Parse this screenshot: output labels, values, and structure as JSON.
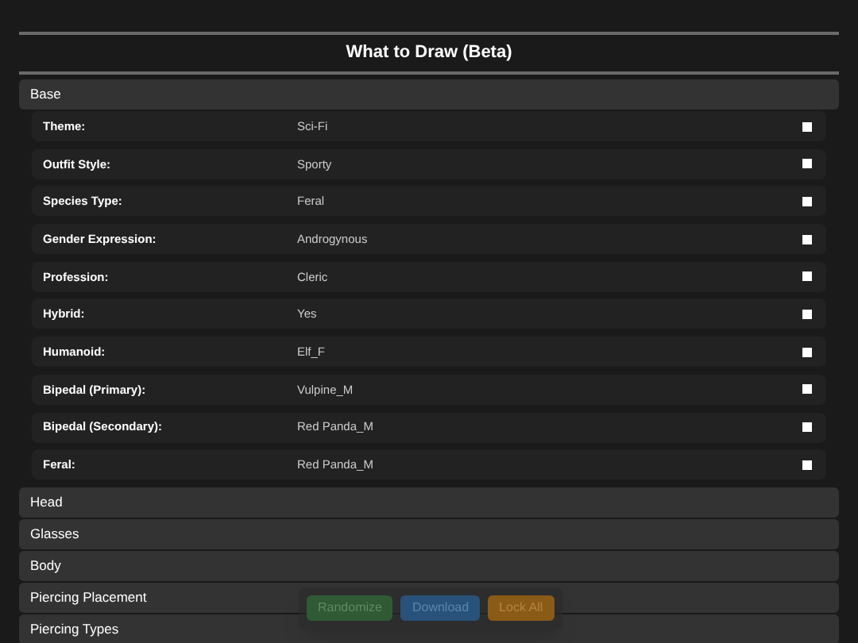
{
  "title": "What to Draw (Beta)",
  "sections": [
    {
      "label": "Base",
      "rows": [
        {
          "label": "Theme:",
          "value": "Sci-Fi",
          "checked": false
        },
        {
          "label": "Outfit Style:",
          "value": "Sporty",
          "checked": false
        },
        {
          "label": "Species Type:",
          "value": "Feral",
          "checked": false
        },
        {
          "label": "Gender Expression:",
          "value": "Androgynous",
          "checked": false
        },
        {
          "label": "Profession:",
          "value": "Cleric",
          "checked": false
        },
        {
          "label": "Hybrid:",
          "value": "Yes",
          "checked": false
        },
        {
          "label": "Humanoid:",
          "value": "Elf_F",
          "checked": false
        },
        {
          "label": "Bipedal (Primary):",
          "value": "Vulpine_M",
          "checked": false
        },
        {
          "label": "Bipedal (Secondary):",
          "value": "Red Panda_M",
          "checked": false
        },
        {
          "label": "Feral:",
          "value": "Red Panda_M",
          "checked": false
        }
      ]
    },
    {
      "label": "Head"
    },
    {
      "label": "Glasses"
    },
    {
      "label": "Body"
    },
    {
      "label": "Piercing Placement"
    },
    {
      "label": "Piercing Types"
    }
  ],
  "actions": [
    {
      "label": "Randomize",
      "kind": "green"
    },
    {
      "label": "Download",
      "kind": "blue"
    },
    {
      "label": "Lock All",
      "kind": "orange"
    }
  ]
}
